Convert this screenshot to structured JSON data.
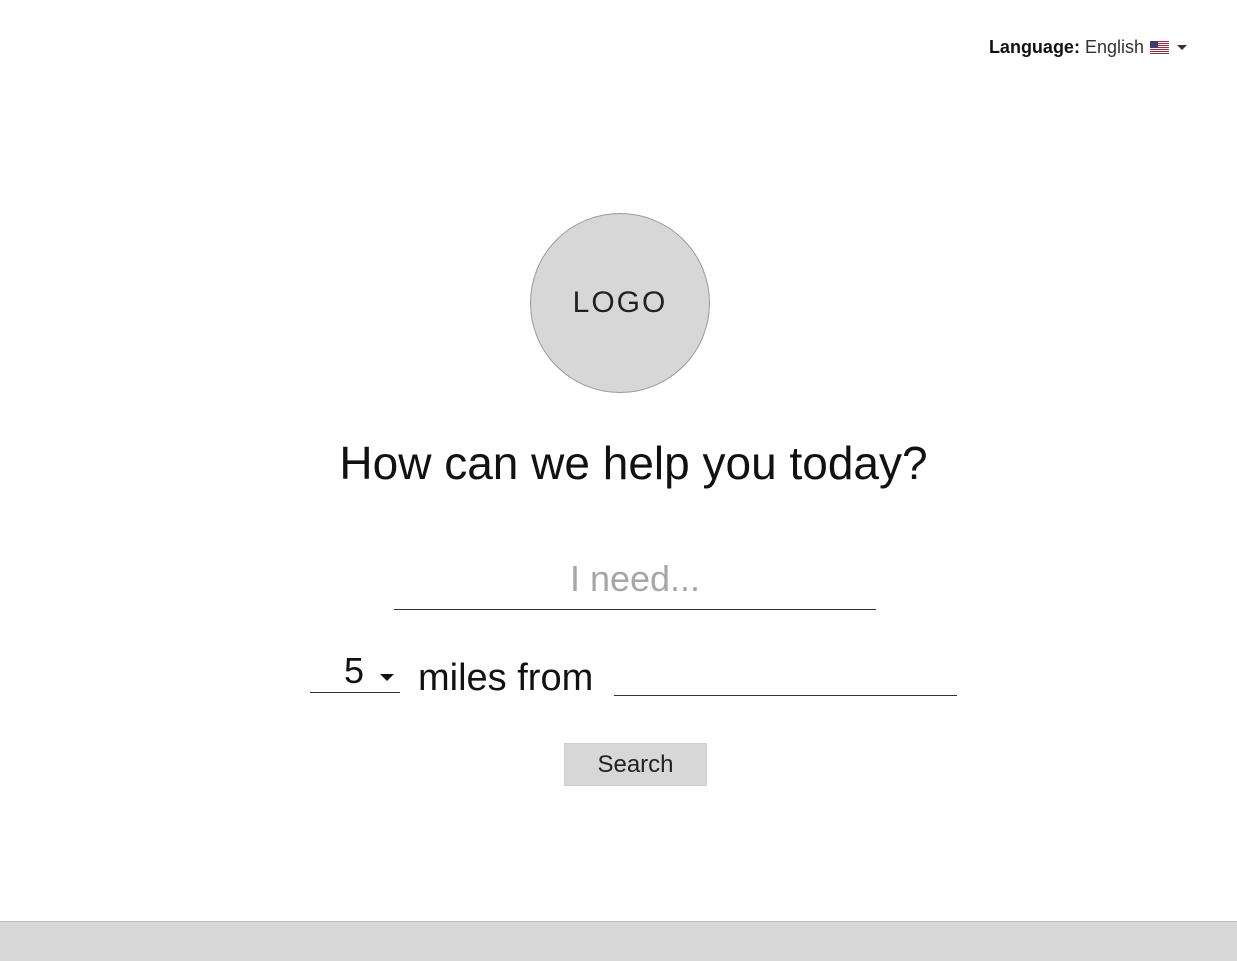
{
  "header": {
    "language_label": "Language:",
    "language_value": "English",
    "flag_icon": "us-flag-icon"
  },
  "logo": {
    "text": "LOGO"
  },
  "main": {
    "headline": "How can we help you today?",
    "need_input": {
      "placeholder": "I need...",
      "value": ""
    },
    "distance": {
      "selected": "5",
      "label": "miles from"
    },
    "location_input": {
      "placeholder": "",
      "value": ""
    },
    "search_label": "Search"
  },
  "colors": {
    "placeholder_gray": "#a6a6a6",
    "logo_fill": "#d7d7d7",
    "button_fill": "#d7d7d7",
    "footer_fill": "#d7d7d7"
  }
}
